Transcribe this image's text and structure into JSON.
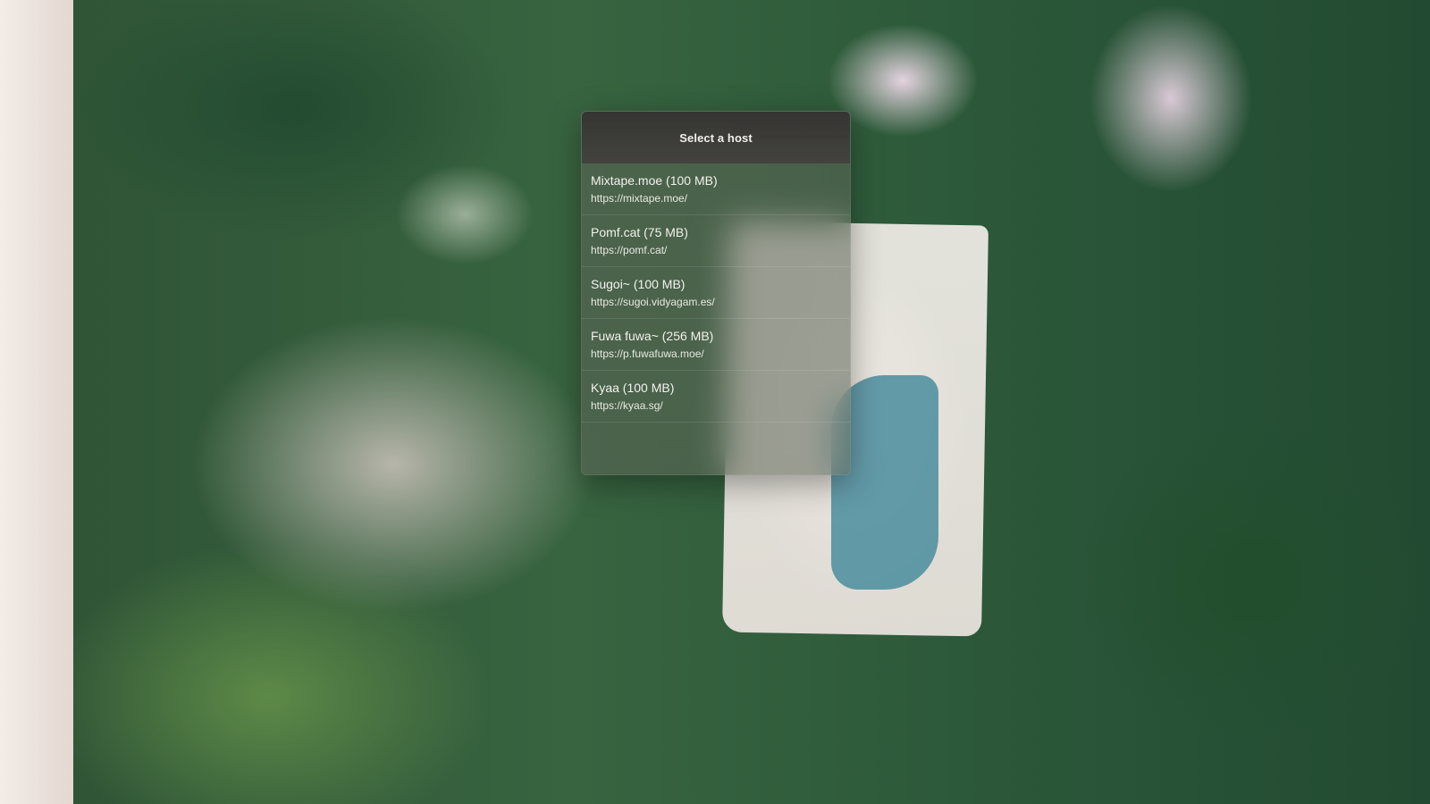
{
  "dialog": {
    "title": "Select a host",
    "hosts": [
      {
        "name": "Mixtape.moe (100 MB)",
        "url": "https://mixtape.moe/"
      },
      {
        "name": "Pomf.cat (75 MB)",
        "url": "https://pomf.cat/"
      },
      {
        "name": "Sugoi~ (100 MB)",
        "url": "https://sugoi.vidyagam.es/"
      },
      {
        "name": "Fuwa fuwa~ (256 MB)",
        "url": "https://p.fuwafuwa.moe/"
      },
      {
        "name": "Kyaa (100 MB)",
        "url": "https://kyaa.sg/"
      }
    ]
  }
}
